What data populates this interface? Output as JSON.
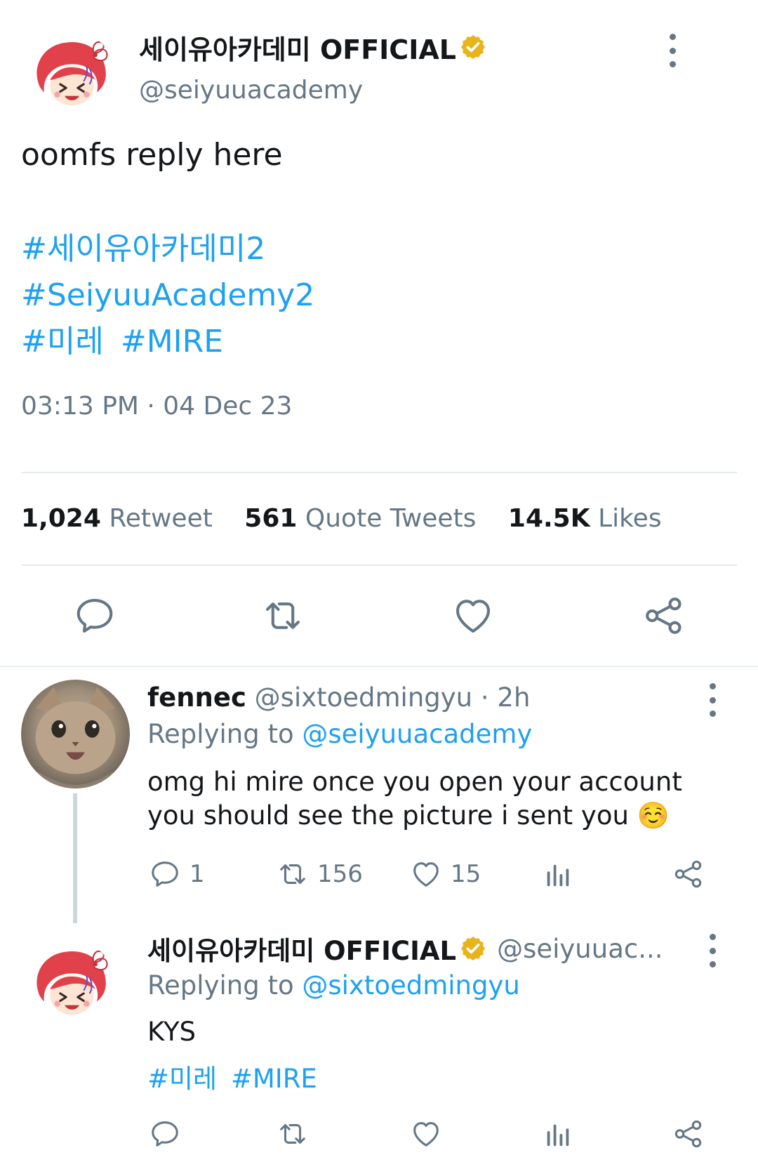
{
  "main_tweet": {
    "display_name": "세이유아카데미 OFFICIAL",
    "handle": "@seiyuuacademy",
    "text": "oomfs reply here",
    "hashtags": [
      "#세이유아카데미2",
      "#SeiyuuAcademy2",
      "#미레",
      "#MIRE"
    ],
    "timestamp": "03:13 PM · 04 Dec 23",
    "stats": {
      "retweets_count": "1,024",
      "retweets_label": "Retweet",
      "quotes_count": "561",
      "quotes_label": "Quote Tweets",
      "likes_count": "14.5K",
      "likes_label": "Likes"
    }
  },
  "replies": [
    {
      "display_name": "fennec",
      "handle": "@sixtoedmingyu",
      "time": "· 2h",
      "replying_label": "Replying to",
      "replying_to": "@seiyuuacademy",
      "text": "omg hi mire once you open your account you should see the picture i sent you ☺️",
      "reply_count": "1",
      "retweet_count": "156",
      "like_count": "15"
    },
    {
      "display_name": "세이유아카데미 OFFICIAL",
      "handle": "@seiyuuac...",
      "replying_label": "Replying to",
      "replying_to": "@sixtoedmingyu",
      "text": "KYS",
      "hashtags": [
        "#미레",
        "#MIRE"
      ]
    }
  ],
  "colors": {
    "link": "#1da1f2",
    "secondary_text": "#657786",
    "verified_badge": "#e8b31b",
    "divider": "#e6ecf0"
  },
  "icons": [
    "reply-icon",
    "retweet-icon",
    "like-icon",
    "share-icon",
    "analytics-icon",
    "more-icon",
    "verified-badge-icon"
  ]
}
